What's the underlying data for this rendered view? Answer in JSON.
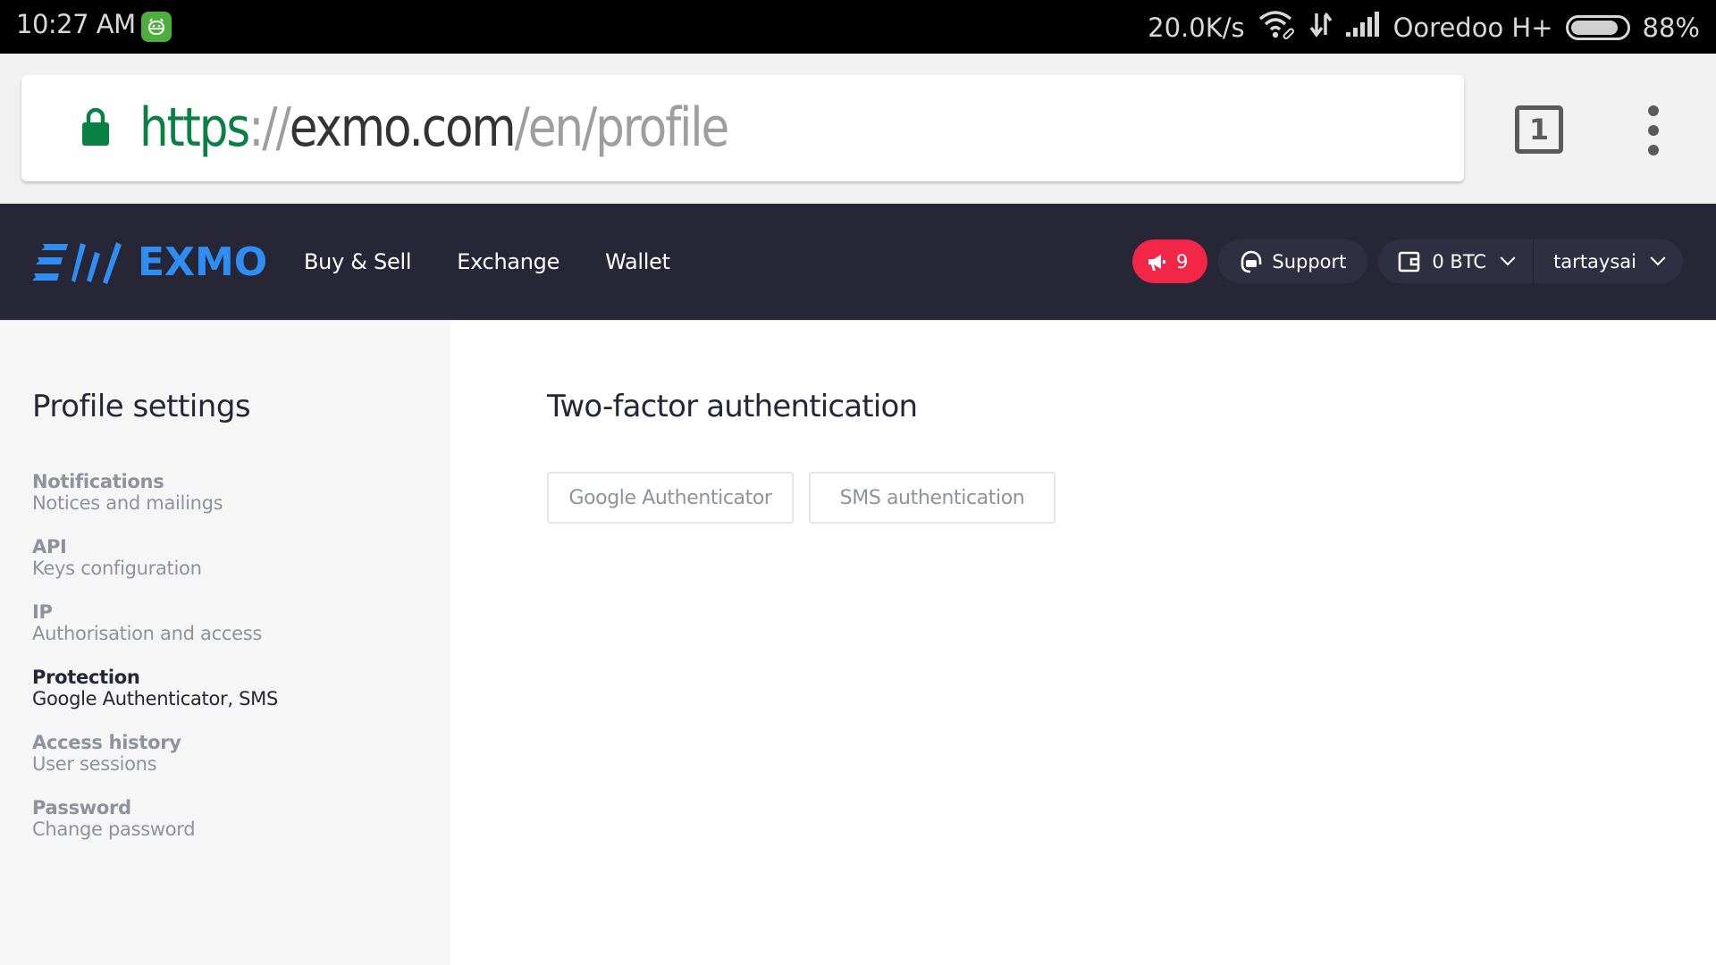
{
  "status_bar": {
    "time": "10:27 AM",
    "app_icon": "android-app-icon",
    "net_speed": "20.0K/s",
    "wifi_icon": "wifi-icon",
    "data_icon": "data-transfer-icon",
    "signal_icon": "signal-icon",
    "carrier": "Ooredoo H+",
    "battery_percent": "88%",
    "battery_level": 0.88
  },
  "browser": {
    "url_scheme": "https",
    "url_sep": "://",
    "url_host": "exmo.com",
    "url_path": "/en/profile",
    "tab_count": "1",
    "colors": {
      "secure": "#0b8043"
    }
  },
  "header": {
    "logo_text": "EXMO",
    "nav": [
      {
        "label": "Buy & Sell"
      },
      {
        "label": "Exchange"
      },
      {
        "label": "Wallet"
      }
    ],
    "notifications_count": "9",
    "support_label": "Support",
    "balance_label": "0 BTC",
    "username": "tartaysai",
    "colors": {
      "brand": "#2f8ef4",
      "background": "#262637",
      "alert": "#f22647"
    }
  },
  "sidebar": {
    "title": "Profile settings",
    "items": [
      {
        "title": "Notifications",
        "subtitle": "Notices and mailings",
        "active": false
      },
      {
        "title": "API",
        "subtitle": "Keys configuration",
        "active": false
      },
      {
        "title": "IP",
        "subtitle": "Authorisation and access",
        "active": false
      },
      {
        "title": "Protection",
        "subtitle": "Google Authenticator, SMS",
        "active": true
      },
      {
        "title": "Access history",
        "subtitle": "User sessions",
        "active": false
      },
      {
        "title": "Password",
        "subtitle": "Change password",
        "active": false
      }
    ]
  },
  "main": {
    "title": "Two-factor authentication",
    "buttons": [
      {
        "label": "Google Authenticator"
      },
      {
        "label": "SMS authentication"
      }
    ]
  }
}
